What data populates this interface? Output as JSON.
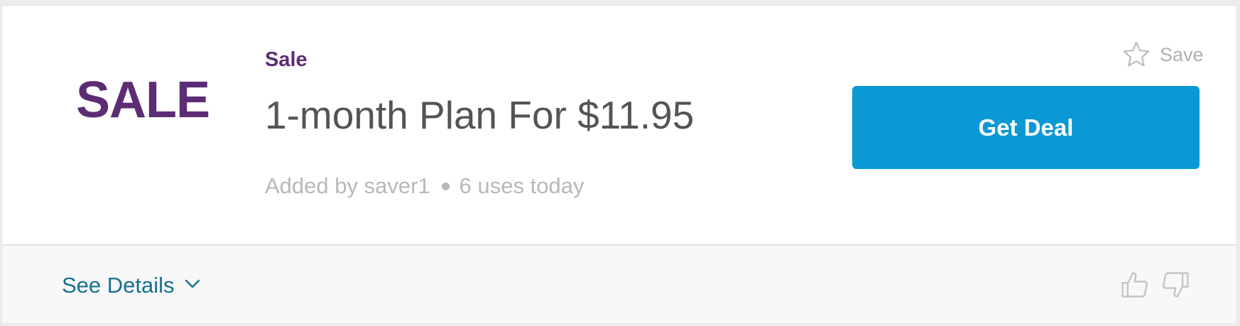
{
  "deal": {
    "badge": "SALE",
    "type_label": "Sale",
    "title": "1-month Plan For $11.95",
    "added_by": "Added by saver1",
    "uses": "6 uses today",
    "save_label": "Save",
    "cta_label": "Get Deal",
    "details_label": "See Details"
  },
  "icons": {
    "save": "star-icon",
    "details": "chevron-down-icon",
    "upvote": "thumbs-up-icon",
    "downvote": "thumbs-down-icon"
  },
  "colors": {
    "brand_purple": "#5c2d74",
    "cta_blue": "#0b99d6",
    "link_teal": "#15708f",
    "title_gray": "#545454",
    "meta_gray": "#b8b8b8"
  }
}
